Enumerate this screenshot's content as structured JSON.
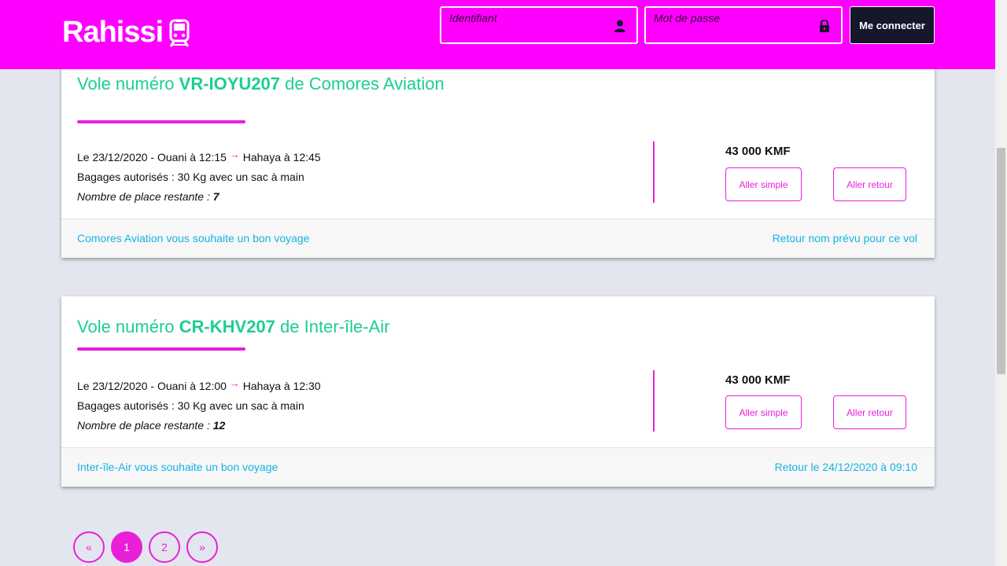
{
  "header": {
    "brand": "Rahissi",
    "username_placeholder": "Identifiant",
    "password_placeholder": "Mot de passe",
    "login_label": "Me connecter",
    "accent_color": "#ff00ff"
  },
  "flights": [
    {
      "title_prefix": "Vole numéro ",
      "code": "VR-IOYU207",
      "title_middle": " de ",
      "company": "Comores Aviation",
      "route_start": "Le 23/12/2020 - Ouani à 12:15",
      "arrow": "→",
      "route_end": "Hahaya à 12:45",
      "baggage": "Bagages autorisés : 30 Kg avec un sac à main",
      "seats_label": "Nombre de place restante : ",
      "seats": "7",
      "price": "43 000 KMF",
      "one_way": "Aller simple",
      "round_trip": "Aller retour",
      "footer_left": "Comores Aviation vous souhaite un bon voyage",
      "footer_right": "Retour nom prévu pour ce vol"
    },
    {
      "title_prefix": "Vole numéro ",
      "code": "CR-KHV207",
      "title_middle": " de ",
      "company": "Inter-île-Air",
      "route_start": "Le 23/12/2020 - Ouani à 12:00",
      "arrow": "→",
      "route_end": "Hahaya à 12:30",
      "baggage": "Bagages autorisés : 30 Kg avec un sac à main",
      "seats_label": "Nombre de place restante : ",
      "seats": "12",
      "price": "43 000 KMF",
      "one_way": "Aller simple",
      "round_trip": "Aller retour",
      "footer_left": "Inter-île-Air vous souhaite un bon voyage",
      "footer_right": "Retour le 24/12/2020 à 09:10"
    }
  ],
  "pagination": {
    "prev": "«",
    "pages": [
      "1",
      "2"
    ],
    "current": "1",
    "next": "»"
  },
  "icons": {
    "brand": "train-icon",
    "username": "user-icon",
    "password": "lock-icon"
  }
}
